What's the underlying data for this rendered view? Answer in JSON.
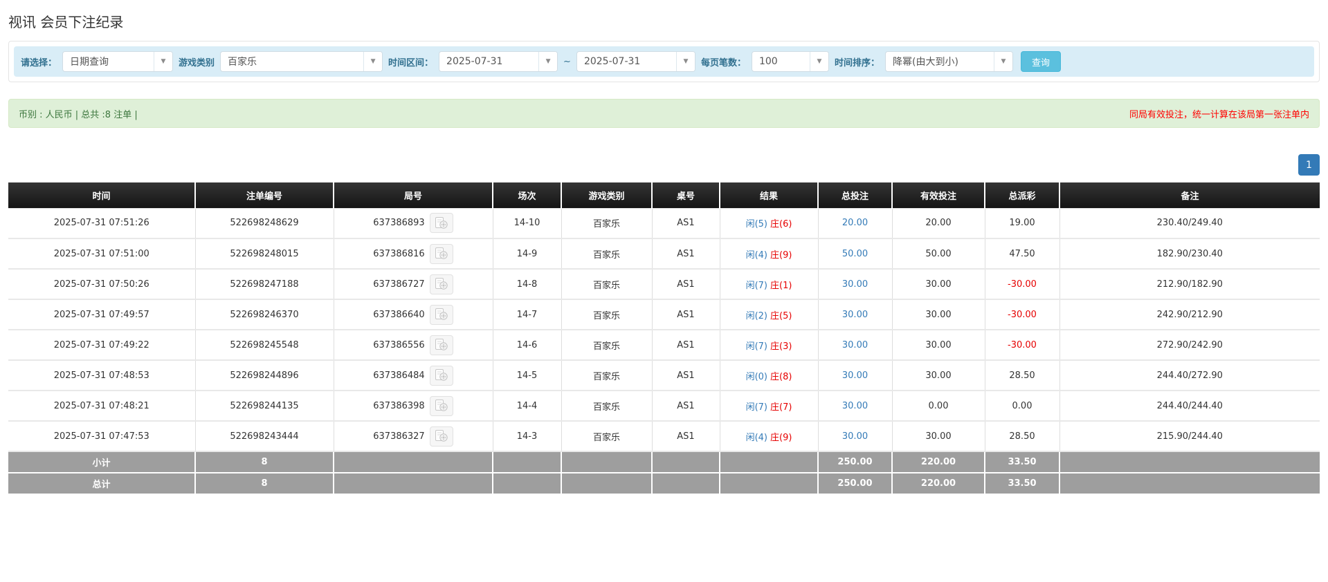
{
  "page": {
    "title": "视讯 会员下注纪录"
  },
  "filters": {
    "select_label": "请选择：",
    "select_value": "日期查询",
    "game_type_label": "游戏类别",
    "game_type_value": "百家乐",
    "date_range_label": "时间区间：",
    "date_from": "2025-07-31",
    "date_separator": "~",
    "date_to": "2025-07-31",
    "page_size_label": "每页笔数：",
    "page_size_value": "100",
    "sort_label": "时间排序：",
    "sort_value": "降幂(由大到小)",
    "search_button": "查询",
    "dropdown_arrow": "▼"
  },
  "summary_bar": {
    "left_text": "币别 : 人民币 | 总共 :8 注单 |",
    "right_text": "同局有效投注，统一计算在该局第一张注单内"
  },
  "pagination": {
    "current_page": "1"
  },
  "table": {
    "headers": [
      "时间",
      "注单编号",
      "局号",
      "场次",
      "游戏类别",
      "桌号",
      "结果",
      "总投注",
      "有效投注",
      "总派彩",
      "备注"
    ],
    "rows": [
      {
        "time": "2025-07-31 07:51:26",
        "bet_no": "522698248629",
        "round_no": "637386893",
        "session": "14-10",
        "game": "百家乐",
        "table_no": "AS1",
        "result_player": "闲(5)",
        "result_banker": "庄(6)",
        "total_bet": "20.00",
        "valid_bet": "20.00",
        "payout": "19.00",
        "note": "230.40/249.40"
      },
      {
        "time": "2025-07-31 07:51:00",
        "bet_no": "522698248015",
        "round_no": "637386816",
        "session": "14-9",
        "game": "百家乐",
        "table_no": "AS1",
        "result_player": "闲(4)",
        "result_banker": "庄(9)",
        "total_bet": "50.00",
        "valid_bet": "50.00",
        "payout": "47.50",
        "note": "182.90/230.40"
      },
      {
        "time": "2025-07-31 07:50:26",
        "bet_no": "522698247188",
        "round_no": "637386727",
        "session": "14-8",
        "game": "百家乐",
        "table_no": "AS1",
        "result_player": "闲(7)",
        "result_banker": "庄(1)",
        "total_bet": "30.00",
        "valid_bet": "30.00",
        "payout": "-30.00",
        "note": "212.90/182.90"
      },
      {
        "time": "2025-07-31 07:49:57",
        "bet_no": "522698246370",
        "round_no": "637386640",
        "session": "14-7",
        "game": "百家乐",
        "table_no": "AS1",
        "result_player": "闲(2)",
        "result_banker": "庄(5)",
        "total_bet": "30.00",
        "valid_bet": "30.00",
        "payout": "-30.00",
        "note": "242.90/212.90"
      },
      {
        "time": "2025-07-31 07:49:22",
        "bet_no": "522698245548",
        "round_no": "637386556",
        "session": "14-6",
        "game": "百家乐",
        "table_no": "AS1",
        "result_player": "闲(7)",
        "result_banker": "庄(3)",
        "total_bet": "30.00",
        "valid_bet": "30.00",
        "payout": "-30.00",
        "note": "272.90/242.90"
      },
      {
        "time": "2025-07-31 07:48:53",
        "bet_no": "522698244896",
        "round_no": "637386484",
        "session": "14-5",
        "game": "百家乐",
        "table_no": "AS1",
        "result_player": "闲(0)",
        "result_banker": "庄(8)",
        "total_bet": "30.00",
        "valid_bet": "30.00",
        "payout": "28.50",
        "note": "244.40/272.90"
      },
      {
        "time": "2025-07-31 07:48:21",
        "bet_no": "522698244135",
        "round_no": "637386398",
        "session": "14-4",
        "game": "百家乐",
        "table_no": "AS1",
        "result_player": "闲(7)",
        "result_banker": "庄(7)",
        "total_bet": "30.00",
        "valid_bet": "0.00",
        "payout": "0.00",
        "note": "244.40/244.40"
      },
      {
        "time": "2025-07-31 07:47:53",
        "bet_no": "522698243444",
        "round_no": "637386327",
        "session": "14-3",
        "game": "百家乐",
        "table_no": "AS1",
        "result_player": "闲(4)",
        "result_banker": "庄(9)",
        "total_bet": "30.00",
        "valid_bet": "30.00",
        "payout": "28.50",
        "note": "215.90/244.40"
      }
    ],
    "subtotal": {
      "label": "小计",
      "count": "8",
      "total_bet": "250.00",
      "valid_bet": "220.00",
      "payout": "33.50"
    },
    "total": {
      "label": "总计",
      "count": "8",
      "total_bet": "250.00",
      "valid_bet": "220.00",
      "payout": "33.50"
    }
  },
  "colors": {
    "filter_bar_bg": "#d9edf7",
    "filter_label": "#31708f",
    "search_button_bg": "#5bc0de",
    "alert_bg": "#dff0d8",
    "alert_text": "#3c763d",
    "alert_warning_text": "#ff0000",
    "pagination_bg": "#337ab7",
    "table_header_bg": "#1c1c1c",
    "summary_row_bg": "#9e9e9e",
    "player_blue": "#337ab7",
    "banker_red": "#e60000",
    "negative_red": "#e60000",
    "bet_link_blue": "#337ab7"
  }
}
